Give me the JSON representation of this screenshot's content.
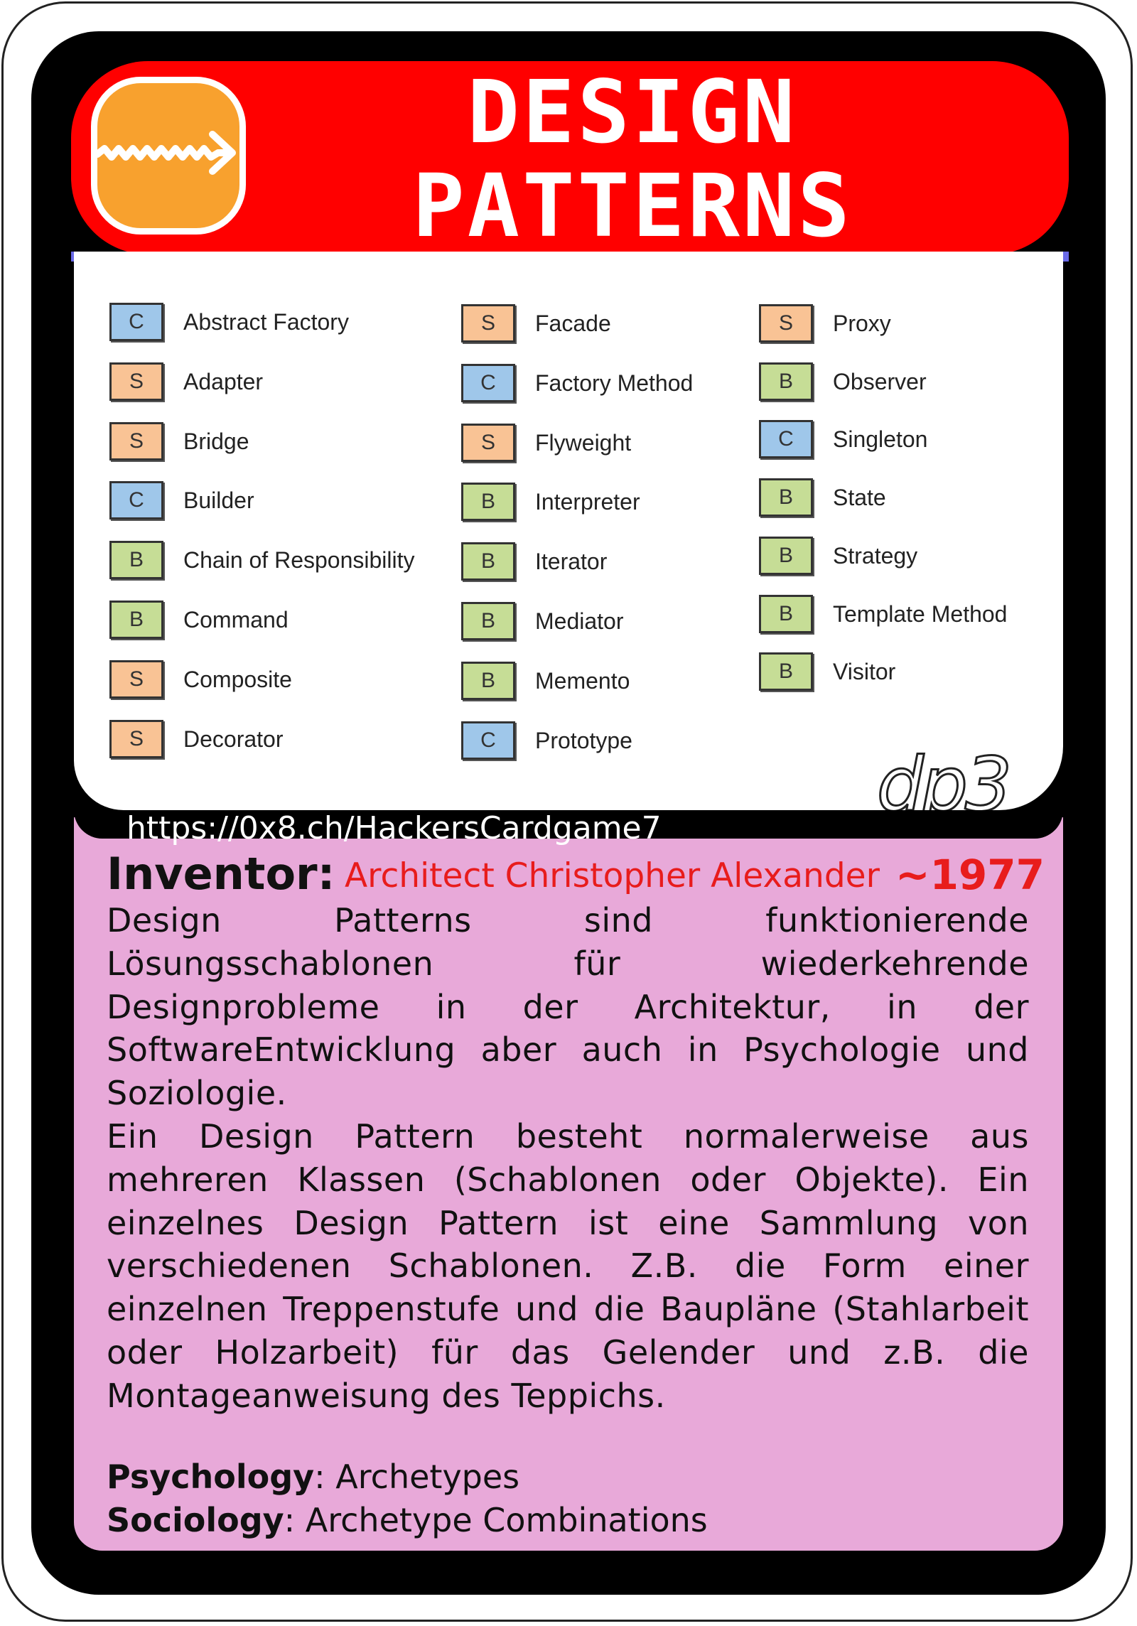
{
  "header": {
    "title_line1": "DESIGN",
    "title_line2": "PATTERNS"
  },
  "logo": {
    "icon": "zigzag-arrow-icon",
    "color": "#f8a12e"
  },
  "category_colors": {
    "C": "#9fc7ea",
    "S": "#f9c395",
    "B": "#c6dd96"
  },
  "patterns": {
    "column1": [
      {
        "category": "C",
        "name": "Abstract Factory"
      },
      {
        "category": "S",
        "name": "Adapter"
      },
      {
        "category": "S",
        "name": "Bridge"
      },
      {
        "category": "C",
        "name": "Builder"
      },
      {
        "category": "B",
        "name": "Chain of Responsibility"
      },
      {
        "category": "B",
        "name": "Command"
      },
      {
        "category": "S",
        "name": "Composite"
      },
      {
        "category": "S",
        "name": "Decorator"
      }
    ],
    "column2": [
      {
        "category": "S",
        "name": "Facade"
      },
      {
        "category": "C",
        "name": "Factory Method"
      },
      {
        "category": "S",
        "name": "Flyweight"
      },
      {
        "category": "B",
        "name": "Interpreter"
      },
      {
        "category": "B",
        "name": "Iterator"
      },
      {
        "category": "B",
        "name": "Mediator"
      },
      {
        "category": "B",
        "name": "Memento"
      },
      {
        "category": "C",
        "name": "Prototype"
      }
    ],
    "column3": [
      {
        "category": "S",
        "name": "Proxy"
      },
      {
        "category": "B",
        "name": "Observer"
      },
      {
        "category": "C",
        "name": "Singleton"
      },
      {
        "category": "B",
        "name": "State"
      },
      {
        "category": "B",
        "name": "Strategy"
      },
      {
        "category": "B",
        "name": "Template Method"
      },
      {
        "category": "B",
        "name": "Visitor"
      }
    ]
  },
  "card_id": "dp3",
  "url": "https://0x8.ch/HackersCardgame7",
  "inventor": {
    "label": "Inventor:",
    "name": "Architect Christopher Alexander",
    "year": "~1977"
  },
  "description": {
    "paragraph1": "Design Patterns sind funktionierende Lösungsschablonen für wiederkehrende Designprobleme in der Architektur, in der SoftwareEntwicklung aber auch in Psychologie und Soziologie.",
    "paragraph2": "Ein Design Pattern besteht normalerweise aus mehreren Klassen (Schablonen oder Objekte). Ein einzelnes Design Pattern ist eine Sammlung von verschiedenen Schablonen. Z.B. die Form einer einzelnen Treppenstufe und die Baupläne (Stahlarbeit oder Holzarbeit) für das Gelender und z.B. die Montageanweisung des Teppichs."
  },
  "facts": {
    "psychology_label": "Psychology",
    "psychology_value": ": Archetypes",
    "sociology_label": "Sociology",
    "sociology_value": ": Archetype Combinations"
  }
}
